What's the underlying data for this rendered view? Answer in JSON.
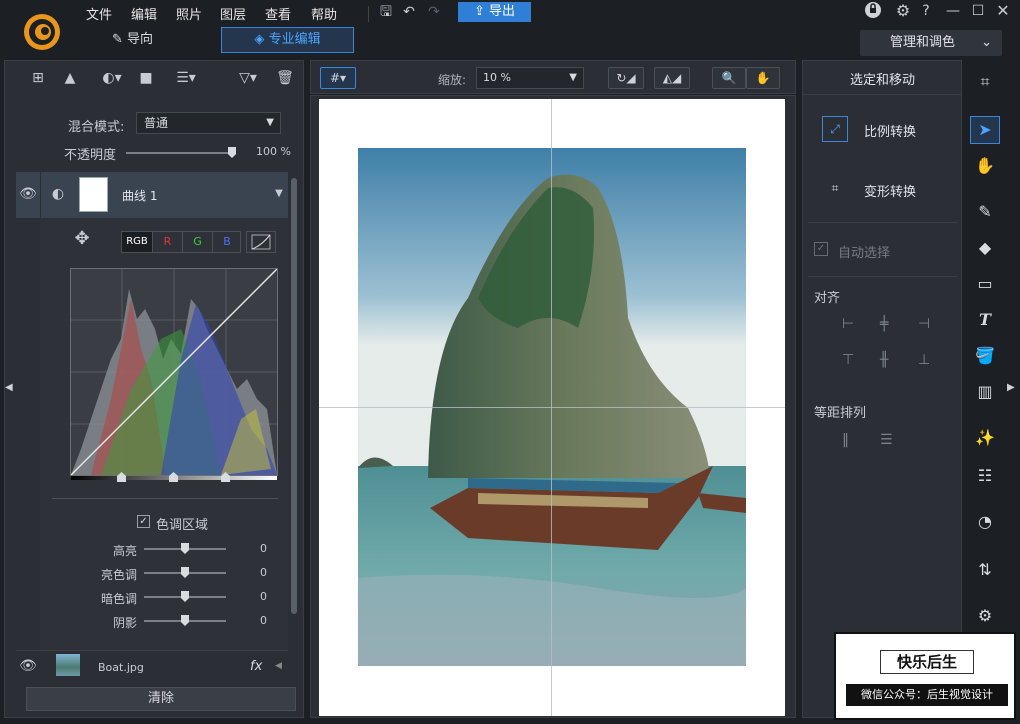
{
  "menu": {
    "file": "文件",
    "edit": "编辑",
    "photo": "照片",
    "layer": "图层",
    "view": "查看",
    "help": "帮助"
  },
  "toolbar": {
    "export_label": "导出"
  },
  "modes": {
    "guide": "导向",
    "pro_edit": "专业编辑",
    "manage": "管理和调色"
  },
  "layers_panel": {
    "blend_label": "混合模式:",
    "blend_value": "普通",
    "opacity_label": "不透明度",
    "opacity_value": "100 %",
    "opacity_level": 1.0,
    "curve_layer_name": "曲线 1",
    "channels": [
      "RGB",
      "R",
      "G",
      "B"
    ],
    "tone_region_label": "色调区域",
    "tone_rows": [
      {
        "label": "高亮",
        "value": "0"
      },
      {
        "label": "亮色调",
        "value": "0"
      },
      {
        "label": "暗色调",
        "value": "0"
      },
      {
        "label": "阴影",
        "value": "0"
      }
    ],
    "image_layer_name": "Boat.jpg",
    "fx_label": "fx",
    "clear_button": "清除"
  },
  "canvas_toolbar": {
    "zoom_label": "缩放:",
    "zoom_value": "10 %"
  },
  "right_panel": {
    "title": "选定和移动",
    "scale_transform": "比例转换",
    "deform_transform": "变形转换",
    "auto_select": "自动选择",
    "align_label": "对齐",
    "distribute_label": "等距排列"
  },
  "watermark": {
    "title": "快乐后生",
    "subtitle": "微信公众号：后生视觉设计"
  },
  "colors": {
    "accent": "#2f7fd6",
    "panel": "#2b2f35",
    "bg": "#1c1f24"
  }
}
